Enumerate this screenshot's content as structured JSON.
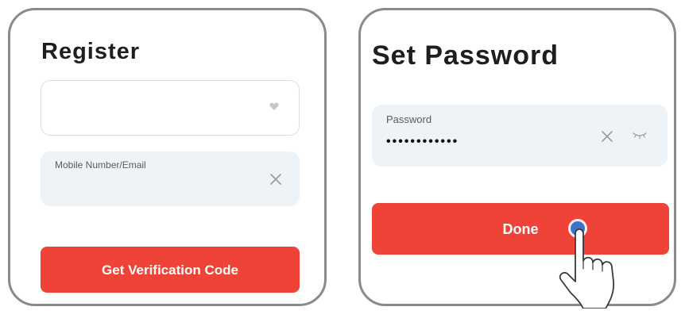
{
  "register": {
    "title": "Register",
    "region_select": {
      "value": "",
      "dropdown_icon": "heart-icon"
    },
    "mobile_field": {
      "label": "Mobile Number/Email",
      "value": "",
      "clear_icon": "close-icon"
    },
    "submit_label": "Get Verification Code"
  },
  "set_password": {
    "title": "Set Password",
    "password_field": {
      "label": "Password",
      "value": "••••••••••••",
      "clear_icon": "close-icon",
      "visibility_icon": "eye-closed-icon"
    },
    "done_label": "Done",
    "pointer_icon": "hand-pointer-icon"
  },
  "colors": {
    "accent": "#f04337",
    "field_bg": "#eef3f8",
    "panel_border": "#8a8a8a",
    "tap_dot": "#3b73c9"
  }
}
